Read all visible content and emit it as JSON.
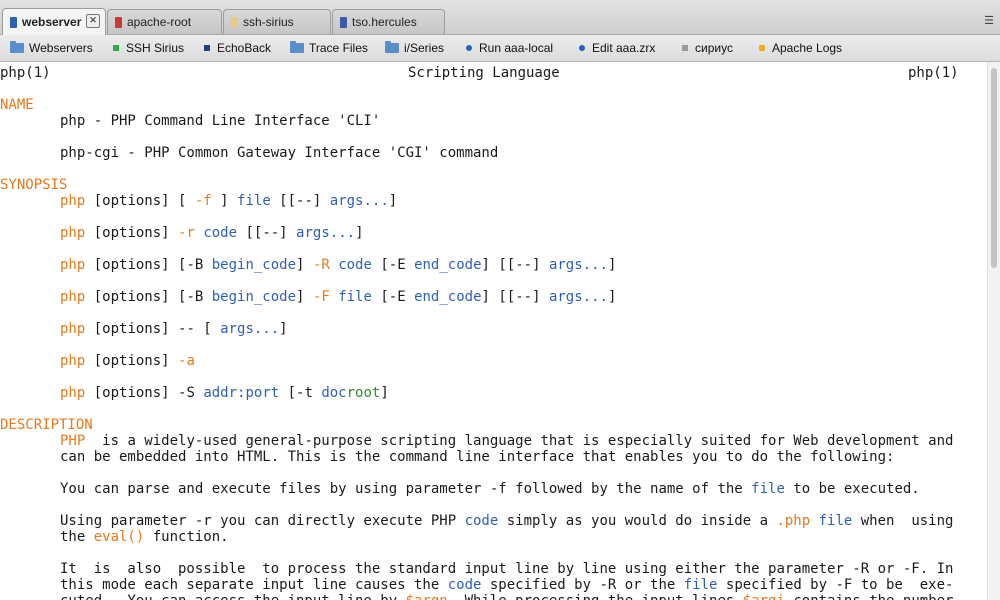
{
  "tabs": [
    {
      "label": "webserver",
      "active": true,
      "color": "#2e5fb5"
    },
    {
      "label": "apache-root",
      "active": false,
      "color": "#c33b3b"
    },
    {
      "label": "ssh-sirius",
      "active": false,
      "color": "#e9c98b"
    },
    {
      "label": "tso.hercules",
      "active": false,
      "color": "#3d5aa8"
    }
  ],
  "tab_close_glyph": "✕",
  "tab_menu_glyph": "☰",
  "bookmarks": [
    {
      "label": "Webservers",
      "icon": "folder-icon"
    },
    {
      "label": "SSH Sirius",
      "icon": "green-square-icon"
    },
    {
      "label": "EchoBack",
      "icon": "blue-square-icon"
    },
    {
      "label": "Trace Files",
      "icon": "folder-icon"
    },
    {
      "label": "i/Series",
      "icon": "folder-icon"
    },
    {
      "label": "Run aaa-local",
      "icon": "blue-dot-icon"
    },
    {
      "label": "Edit aaa.zrx",
      "icon": "blue-dot-icon"
    },
    {
      "label": "сириус",
      "icon": "gray-square-icon"
    },
    {
      "label": "Apache Logs",
      "icon": "yellow-square-icon"
    }
  ],
  "man": {
    "header": {
      "left": "php(1)",
      "center": "Scripting Language",
      "right": "php(1)"
    },
    "sections": {
      "name": "NAME",
      "synopsis": "SYNOPSIS",
      "description": "DESCRIPTION"
    },
    "name_lines": [
      "php - PHP Command Line Interface 'CLI'",
      "php-cgi - PHP Common Gateway Interface 'CGI' command"
    ],
    "synopsis": [
      "php [options] [ -f ] file [[--] args...]",
      "php [options] -r code [[--] args...]",
      "php [options] [-B begin_code] -R code [-E end_code] [[--] args...]",
      "php [options] [-B begin_code] -F file [-E end_code] [[--] args...]",
      "php [options] -- [ args...]",
      "php [options] -a",
      "php [options] -S addr:port [-t docroot]"
    ],
    "description": {
      "p1_l1": "PHP  is a widely-used general-purpose scripting language that is especially suited for Web development and",
      "p1_l2": "can be embedded into HTML. This is the command line interface that enables you to do the following:",
      "p2": "You can parse and execute files by using parameter -f followed by the name of the file to be executed.",
      "p3_l1": "Using parameter -r you can directly execute PHP code simply as you would do inside a .php file when  using",
      "p3_l2": "the eval() function.",
      "p4_l1": "It  is  also  possible  to process the standard input line by line using either the parameter -R or -F. In",
      "p4_l2": "this mode each separate input line causes the code specified by -R or the file specified by -F to be  exe-",
      "p4_l3": "cuted.  You can access the input line by $argn. While processing the input lines $argi contains the number"
    }
  },
  "colors": {
    "section": "#e8791c",
    "keyword": "#e8791c",
    "link": "#2e5fb5",
    "path": "#2f8b2f"
  }
}
